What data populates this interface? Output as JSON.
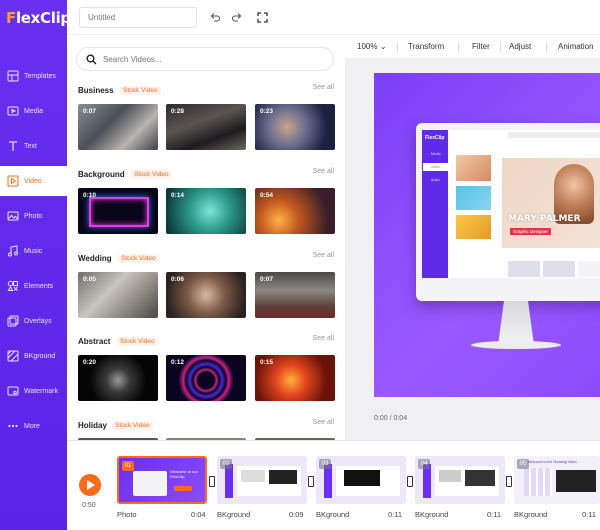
{
  "app": {
    "logo_prefix": "F",
    "logo_rest": "lexClip"
  },
  "nav": [
    {
      "label": "Templates",
      "icon": "templates-icon"
    },
    {
      "label": "Media",
      "icon": "media-icon"
    },
    {
      "label": "Text",
      "icon": "text-icon"
    },
    {
      "label": "Video",
      "icon": "video-icon",
      "active": true
    },
    {
      "label": "Photo",
      "icon": "photo-icon"
    },
    {
      "label": "Music",
      "icon": "music-icon"
    },
    {
      "label": "Elements",
      "icon": "elements-icon"
    },
    {
      "label": "Overlays",
      "icon": "overlays-icon"
    },
    {
      "label": "BKground",
      "icon": "bkground-icon"
    },
    {
      "label": "Watermark",
      "icon": "watermark-icon"
    },
    {
      "label": "More",
      "icon": "more-icon"
    }
  ],
  "topbar": {
    "title_placeholder": "Untitled"
  },
  "search": {
    "placeholder": "Search Videos..."
  },
  "sections": [
    {
      "title": "Business",
      "badge": "Stock Video",
      "see_all": "See all",
      "durations": [
        "0:07",
        "0:28",
        "0:23"
      ]
    },
    {
      "title": "Background",
      "badge": "Stock Video",
      "see_all": "See all",
      "durations": [
        "0:10",
        "0:14",
        "0:54"
      ]
    },
    {
      "title": "Wedding",
      "badge": "Stock Video",
      "see_all": "See all",
      "durations": [
        "0:05",
        "0:06",
        "0:07"
      ]
    },
    {
      "title": "Abstract",
      "badge": "Stock Video",
      "see_all": "See all",
      "durations": [
        "0:20",
        "0:12",
        "0:15"
      ]
    },
    {
      "title": "Holiday",
      "badge": "Stock Video",
      "see_all": "See all",
      "durations": []
    }
  ],
  "toolbar": {
    "zoom": "100%",
    "transform": "Transform",
    "filter": "Filter",
    "adjust": "Adjust",
    "animation": "Animation"
  },
  "canvas": {
    "time": "0:00 / 0:04",
    "mock_logo": "FlexClip",
    "mock_nav": [
      "Media",
      "Video",
      "Audio"
    ],
    "name": "MARY PALMER",
    "role": "Graphic Designer"
  },
  "timeline": {
    "total": "0:50",
    "clips": [
      {
        "num": "01",
        "label": "Photo",
        "duration": "0:04",
        "active": true,
        "caption": "Welcome to our FlexClip"
      },
      {
        "num": "02",
        "label": "BKground",
        "duration": "0:09"
      },
      {
        "num": "03",
        "label": "BKground",
        "duration": "0:11"
      },
      {
        "num": "04",
        "label": "BKground",
        "duration": "0:11"
      },
      {
        "num": "05",
        "label": "BKground",
        "duration": "0:11",
        "caption": "Welcome to the Showing Video"
      }
    ]
  },
  "colors": {
    "sidebar": "#5f28ea",
    "accent": "#ff6a1a",
    "canvas": "#8a4bfb"
  }
}
